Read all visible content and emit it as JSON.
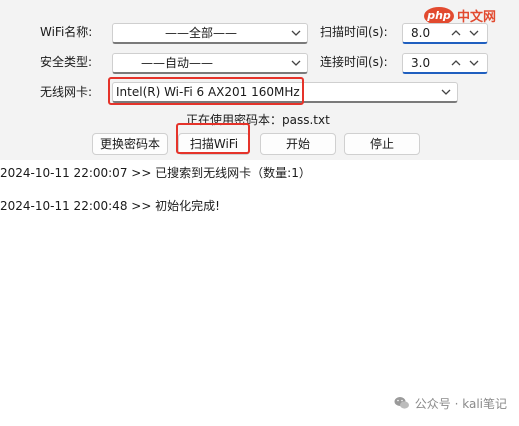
{
  "form": {
    "wifi_name_label": "WiFi名称:",
    "wifi_name_value": "——全部——",
    "scan_time_label": "扫描时间(s):",
    "scan_time_value": "8.0",
    "security_label": "安全类型:",
    "security_value": "——自动——",
    "connect_time_label": "连接时间(s):",
    "connect_time_value": "3.0",
    "nic_label": "无线网卡:",
    "nic_value": "Intel(R) Wi-Fi 6 AX201 160MHz",
    "password_file_text": "正在使用密码本：pass.txt"
  },
  "buttons": {
    "change_dict": "更换密码本",
    "scan_wifi": "扫描WiFi",
    "start": "开始",
    "stop": "停止"
  },
  "log": {
    "lines": [
      "2024-10-11 22:00:07 >> 已搜索到无线网卡（数量:1）",
      "2024-10-11 22:00:48 >> 初始化完成!"
    ]
  },
  "watermark": {
    "text": "公众号 · kali笔记"
  },
  "site_logo": {
    "badge": "php",
    "text": "中文网"
  },
  "colors": {
    "highlight_box": "#e5332a",
    "accent": "#1f5fbf"
  }
}
